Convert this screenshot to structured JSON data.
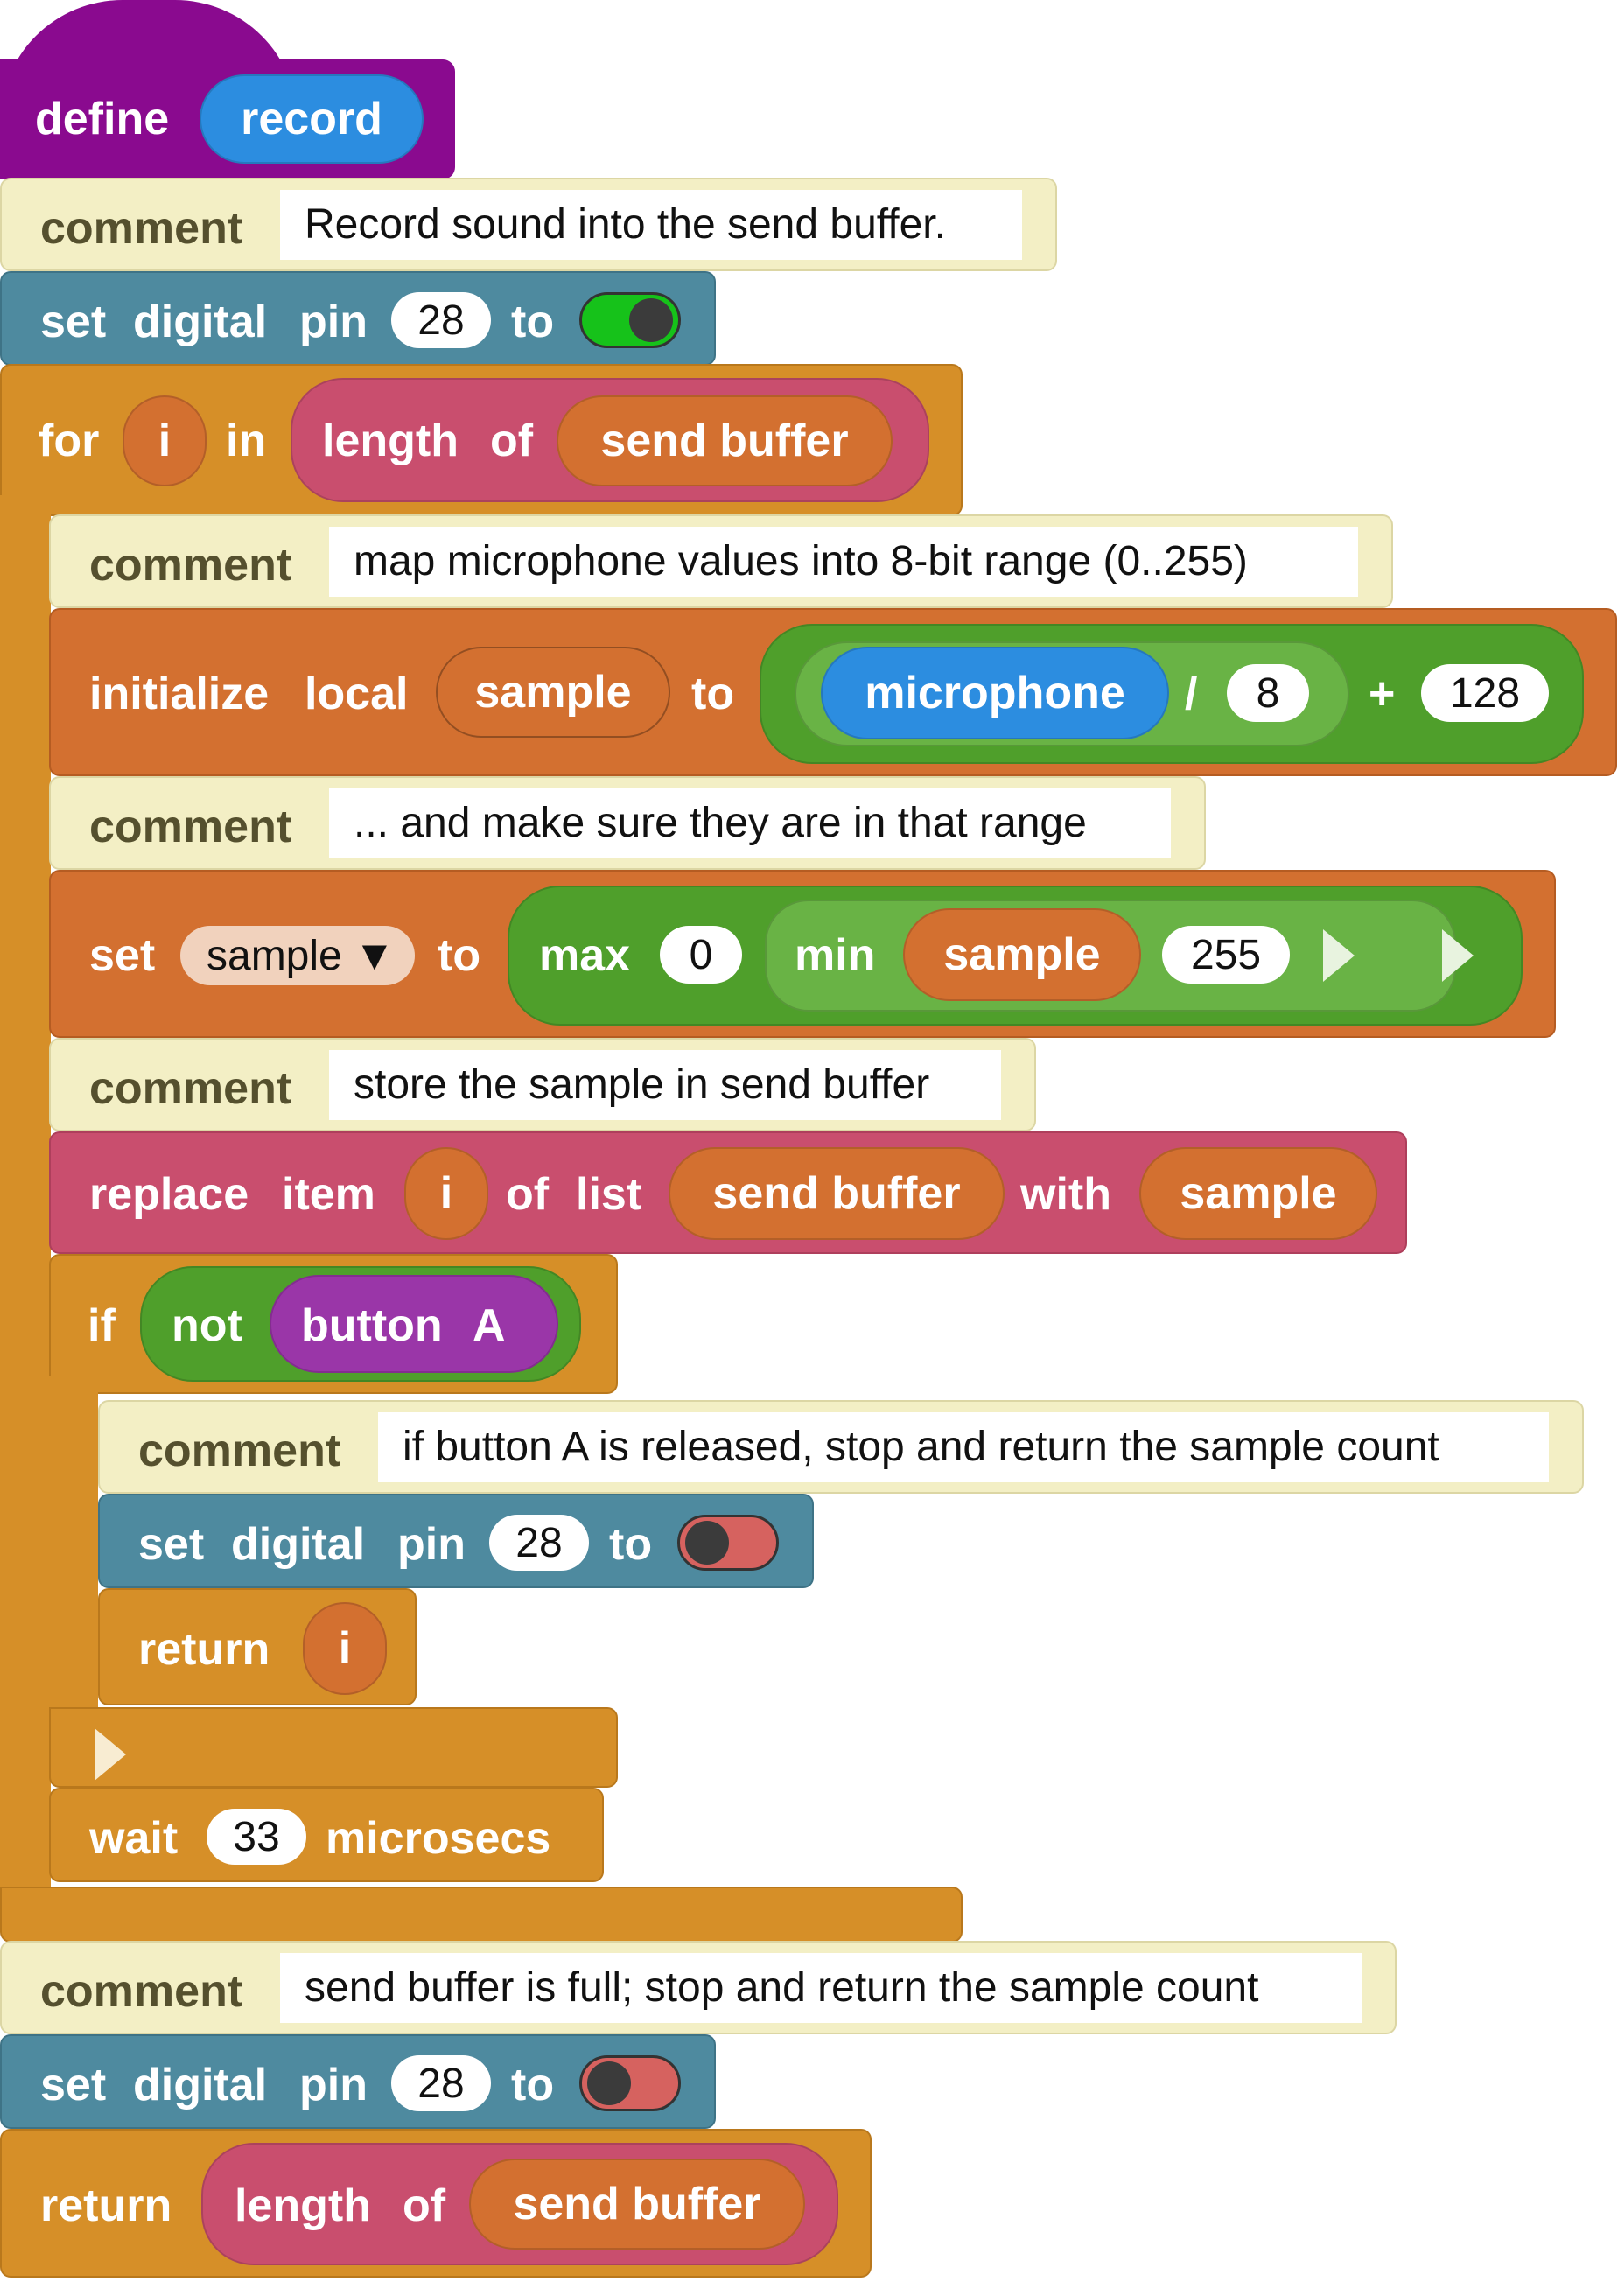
{
  "define": {
    "keyword": "define",
    "name": "record"
  },
  "blocks": {
    "comment1": {
      "kw": "comment",
      "text": "Record sound into the send buffer."
    },
    "set_pin1": {
      "set": "set",
      "digital": "digital",
      "pin": "pin",
      "value": "28",
      "to": "to",
      "state": "on"
    },
    "for_loop": {
      "for": "for",
      "var": "i",
      "in": "in",
      "length": "length",
      "of": "of",
      "list": "send buffer"
    },
    "comment2": {
      "kw": "comment",
      "text": "map microphone values into 8-bit range (0..255)"
    },
    "init_local": {
      "initialize": "initialize",
      "local": "local",
      "var": "sample",
      "to": "to",
      "sensor": "microphone",
      "div": "/",
      "divisor": "8",
      "plus": "+",
      "offset": "128"
    },
    "comment3": {
      "kw": "comment",
      "text": "... and make sure they are in that range"
    },
    "set_sample": {
      "set": "set",
      "var": "sample ▼",
      "to": "to",
      "max": "max",
      "max_arg": "0",
      "min": "min",
      "min_var": "sample",
      "min_arg": "255"
    },
    "comment4": {
      "kw": "comment",
      "text": "store the sample in send buffer"
    },
    "replace": {
      "replace": "replace",
      "item": "item",
      "index": "i",
      "of": "of",
      "list_kw": "list",
      "list": "send buffer",
      "with": "with",
      "value": "sample"
    },
    "if_block": {
      "if": "if",
      "not": "not",
      "button": "button",
      "button_name": "A"
    },
    "comment5": {
      "kw": "comment",
      "text": "if button A is released, stop and return the sample count"
    },
    "set_pin2": {
      "set": "set",
      "digital": "digital",
      "pin": "pin",
      "value": "28",
      "to": "to",
      "state": "off"
    },
    "return1": {
      "kw": "return",
      "value": "i"
    },
    "wait": {
      "kw": "wait",
      "value": "33",
      "unit": "microsecs"
    },
    "comment6": {
      "kw": "comment",
      "text": "send buffer is full; stop and return the sample count"
    },
    "set_pin3": {
      "set": "set",
      "digital": "digital",
      "pin": "pin",
      "value": "28",
      "to": "to",
      "state": "off"
    },
    "return2": {
      "kw": "return",
      "length": "length",
      "of": "of",
      "list": "send buffer"
    }
  },
  "colors": {
    "define": "#8a0a8f",
    "control": "#d68f28",
    "io": "#4e8a9f",
    "variables": "#d37030",
    "lists": "#c94e6e",
    "operators": "#4f9f2b",
    "comment": "#f3efc5",
    "sensor": "#2c8de0"
  }
}
